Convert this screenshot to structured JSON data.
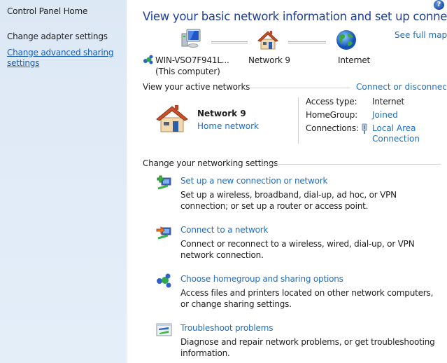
{
  "sidebar": {
    "home": "Control Panel Home",
    "items": [
      {
        "label": "Change adapter settings"
      },
      {
        "label": "Change advanced sharing settings"
      }
    ]
  },
  "header": {
    "title": "View your basic network information and set up connections",
    "help_icon": "help-icon",
    "see_full_map": "See full map"
  },
  "map": {
    "computer": {
      "name": "WIN-VSO7F941L...",
      "sub": "(This computer)",
      "icon": "computer-icon"
    },
    "network": {
      "name": "Network  9",
      "icon": "house-icon"
    },
    "internet": {
      "name": "Internet",
      "icon": "globe-icon"
    }
  },
  "active": {
    "heading": "View your active networks",
    "connect_link": "Connect or disconnect",
    "network_name": "Network  9",
    "network_type": "Home network",
    "props": [
      {
        "label": "Access type:",
        "value": "Internet",
        "link": false
      },
      {
        "label": "HomeGroup:",
        "value": "Joined",
        "link": true
      },
      {
        "label": "Connections:",
        "value": "Local Area Connection",
        "link": true,
        "icon": "ethernet-plug-icon"
      }
    ]
  },
  "settings": {
    "heading": "Change your networking settings",
    "tasks": [
      {
        "title": "Set up a new connection or network",
        "desc": "Set up a wireless, broadband, dial-up, ad hoc, or VPN connection; or set up a router or access point.",
        "icon": "new-connection-icon"
      },
      {
        "title": "Connect to a network",
        "desc": "Connect or reconnect to a wireless, wired, dial-up, or VPN network connection.",
        "icon": "connect-network-icon"
      },
      {
        "title": "Choose homegroup and sharing options",
        "desc": "Access files and printers located on other network computers, or change sharing settings.",
        "icon": "homegroup-icon"
      },
      {
        "title": "Troubleshoot problems",
        "desc": "Diagnose and repair network problems, or get troubleshooting information.",
        "icon": "troubleshoot-icon"
      }
    ]
  }
}
